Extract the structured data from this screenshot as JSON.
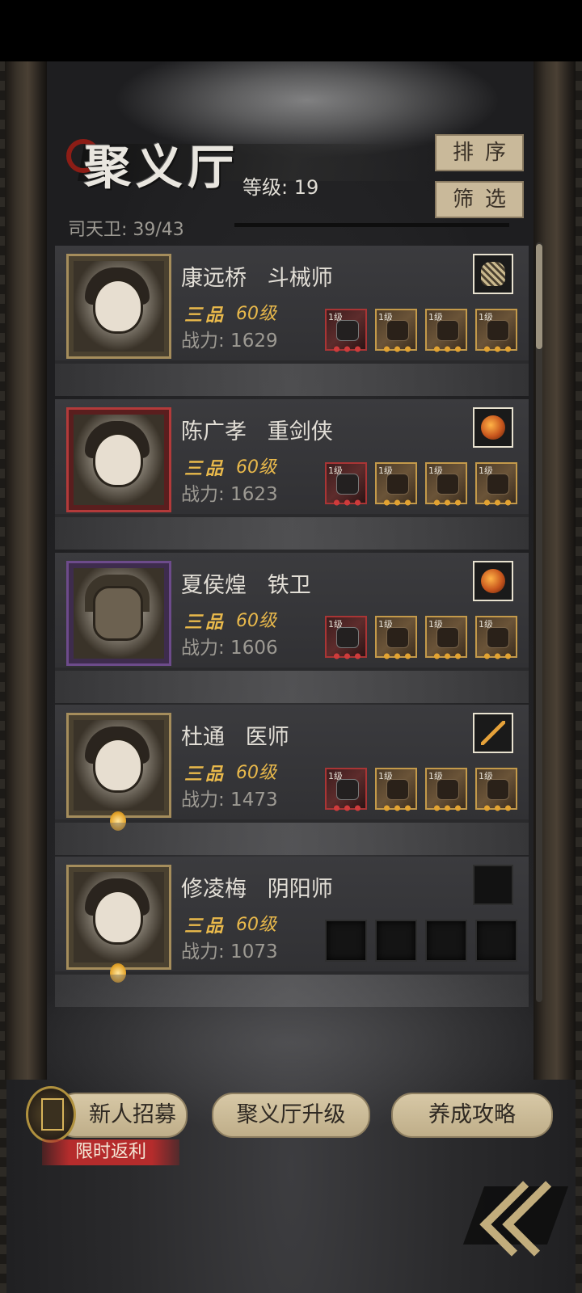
{
  "header": {
    "title": "聚义厅",
    "level_text": "等级: 19",
    "guards_text": "司天卫: 39/43",
    "sort_button": "排序",
    "filter_button": "筛选"
  },
  "heroes": [
    {
      "name_line": "康远桥   斗械师",
      "rank": "三品",
      "level": "60级",
      "power": "战力: 1629",
      "relic": "mesh-cap",
      "gear": [
        {
          "lvl": "1级",
          "kind": "red"
        },
        {
          "lvl": "1级",
          "kind": "gold"
        },
        {
          "lvl": "1级",
          "kind": "gold"
        },
        {
          "lvl": "1级",
          "kind": "gold"
        }
      ]
    },
    {
      "name_line": "陈广孝   重剑侠",
      "rank": "三品",
      "level": "60级",
      "power": "战力: 1623",
      "relic": "amber-stone",
      "gear": [
        {
          "lvl": "1级",
          "kind": "red"
        },
        {
          "lvl": "1级",
          "kind": "gold"
        },
        {
          "lvl": "1级",
          "kind": "gold"
        },
        {
          "lvl": "1级",
          "kind": "gold"
        }
      ]
    },
    {
      "name_line": "夏侯煌   铁卫",
      "rank": "三品",
      "level": "60级",
      "power": "战力: 1606",
      "relic": "amber-stone",
      "gear": [
        {
          "lvl": "1级",
          "kind": "red"
        },
        {
          "lvl": "1级",
          "kind": "gold"
        },
        {
          "lvl": "1级",
          "kind": "gold"
        },
        {
          "lvl": "1级",
          "kind": "gold"
        }
      ]
    },
    {
      "name_line": "杜通   医师",
      "rank": "三品",
      "level": "60级",
      "power": "战力: 1473",
      "relic": "golden-staff",
      "gear": [
        {
          "lvl": "1级",
          "kind": "red"
        },
        {
          "lvl": "1级",
          "kind": "gold"
        },
        {
          "lvl": "1级",
          "kind": "gold"
        },
        {
          "lvl": "1级",
          "kind": "gold"
        }
      ]
    },
    {
      "name_line": "修凌梅   阴阳师",
      "rank": "三品",
      "level": "60级",
      "power": "战力: 1073",
      "relic": "empty",
      "gear": [
        {
          "lvl": "",
          "kind": "empty"
        },
        {
          "lvl": "",
          "kind": "empty"
        },
        {
          "lvl": "",
          "kind": "empty"
        },
        {
          "lvl": "",
          "kind": "empty"
        }
      ]
    }
  ],
  "footer": {
    "recruit_button": "新人招募",
    "upgrade_button": "聚义厅升级",
    "guide_button": "养成攻略",
    "promo_tag": "限时返利"
  },
  "colors": {
    "gold": "#e9b94b",
    "button": "#c9b99a",
    "promo": "#b52c2c"
  }
}
